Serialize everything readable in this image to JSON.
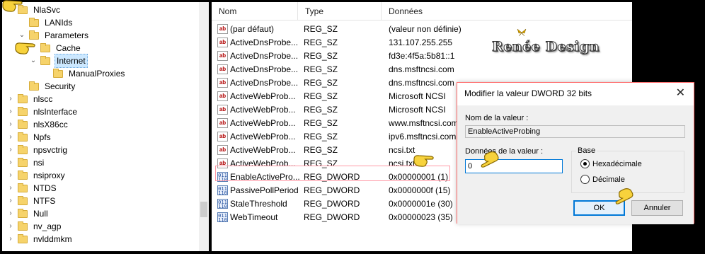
{
  "tree": {
    "items": [
      {
        "label": "NlaSvc",
        "level": 0,
        "expand": "⌄"
      },
      {
        "label": "LANIds",
        "level": 1,
        "expand": ""
      },
      {
        "label": "Parameters",
        "level": 1,
        "expand": "⌄"
      },
      {
        "label": "Cache",
        "level": 2,
        "expand": ""
      },
      {
        "label": "Internet",
        "level": 2,
        "expand": "⌄",
        "selected": true
      },
      {
        "label": "ManualProxies",
        "level": 3,
        "expand": ""
      },
      {
        "label": "Security",
        "level": 1,
        "expand": ""
      },
      {
        "label": "nlscc",
        "level": 0,
        "expand": "›"
      },
      {
        "label": "nlsInterface",
        "level": 0,
        "expand": "›"
      },
      {
        "label": "nlsX86cc",
        "level": 0,
        "expand": "›"
      },
      {
        "label": "Npfs",
        "level": 0,
        "expand": "›"
      },
      {
        "label": "npsvctrig",
        "level": 0,
        "expand": "›"
      },
      {
        "label": "nsi",
        "level": 0,
        "expand": "›"
      },
      {
        "label": "nsiproxy",
        "level": 0,
        "expand": "›"
      },
      {
        "label": "NTDS",
        "level": 0,
        "expand": "›"
      },
      {
        "label": "NTFS",
        "level": 0,
        "expand": "›"
      },
      {
        "label": "Null",
        "level": 0,
        "expand": "›"
      },
      {
        "label": "nv_agp",
        "level": 0,
        "expand": "›"
      },
      {
        "label": "nvlddmkm",
        "level": 0,
        "expand": "›"
      }
    ]
  },
  "list": {
    "headers": {
      "name": "Nom",
      "type": "Type",
      "data": "Données"
    },
    "rows": [
      {
        "name": "(par défaut)",
        "type": "REG_SZ",
        "data": "(valeur non définie)",
        "icon": "sz"
      },
      {
        "name": "ActiveDnsProbe...",
        "type": "REG_SZ",
        "data": "131.107.255.255",
        "icon": "sz"
      },
      {
        "name": "ActiveDnsProbe...",
        "type": "REG_SZ",
        "data": "fd3e:4f5a:5b81::1",
        "icon": "sz"
      },
      {
        "name": "ActiveDnsProbe...",
        "type": "REG_SZ",
        "data": "dns.msftncsi.com",
        "icon": "sz"
      },
      {
        "name": "ActiveDnsProbe...",
        "type": "REG_SZ",
        "data": "dns.msftncsi.com",
        "icon": "sz"
      },
      {
        "name": "ActiveWebProb...",
        "type": "REG_SZ",
        "data": "Microsoft NCSI",
        "icon": "sz"
      },
      {
        "name": "ActiveWebProb...",
        "type": "REG_SZ",
        "data": "Microsoft NCSI",
        "icon": "sz"
      },
      {
        "name": "ActiveWebProb...",
        "type": "REG_SZ",
        "data": "www.msftncsi.com",
        "icon": "sz"
      },
      {
        "name": "ActiveWebProb...",
        "type": "REG_SZ",
        "data": "ipv6.msftncsi.com",
        "icon": "sz"
      },
      {
        "name": "ActiveWebProb...",
        "type": "REG_SZ",
        "data": "ncsi.txt",
        "icon": "sz"
      },
      {
        "name": "ActiveWebProb...",
        "type": "REG_SZ",
        "data": "ncsi.txt",
        "icon": "sz"
      },
      {
        "name": "EnableActivePro...",
        "type": "REG_DWORD",
        "data": "0x00000001 (1)",
        "icon": "dword"
      },
      {
        "name": "PassivePollPeriod",
        "type": "REG_DWORD",
        "data": "0x0000000f (15)",
        "icon": "dword"
      },
      {
        "name": "StaleThreshold",
        "type": "REG_DWORD",
        "data": "0x0000001e (30)",
        "icon": "dword"
      },
      {
        "name": "WebTimeout",
        "type": "REG_DWORD",
        "data": "0x00000023 (35)",
        "icon": "dword"
      }
    ]
  },
  "icons": {
    "sz": "ab",
    "dword": "011\n110"
  },
  "watermark": "Renée Design",
  "dialog": {
    "title": "Modifier la valeur DWORD 32 bits",
    "close": "✕",
    "name_label": "Nom de la valeur :",
    "name_value": "EnableActiveProbing",
    "data_label": "Données de la valeur :",
    "data_value": "0",
    "base_label": "Base",
    "radio_hex": "Hexadécimale",
    "radio_dec": "Décimale",
    "ok": "OK",
    "cancel": "Annuler"
  },
  "colors": {
    "accent": "#0078d7",
    "dialog_border": "#ff6a6a",
    "selection": "#cce8ff"
  }
}
